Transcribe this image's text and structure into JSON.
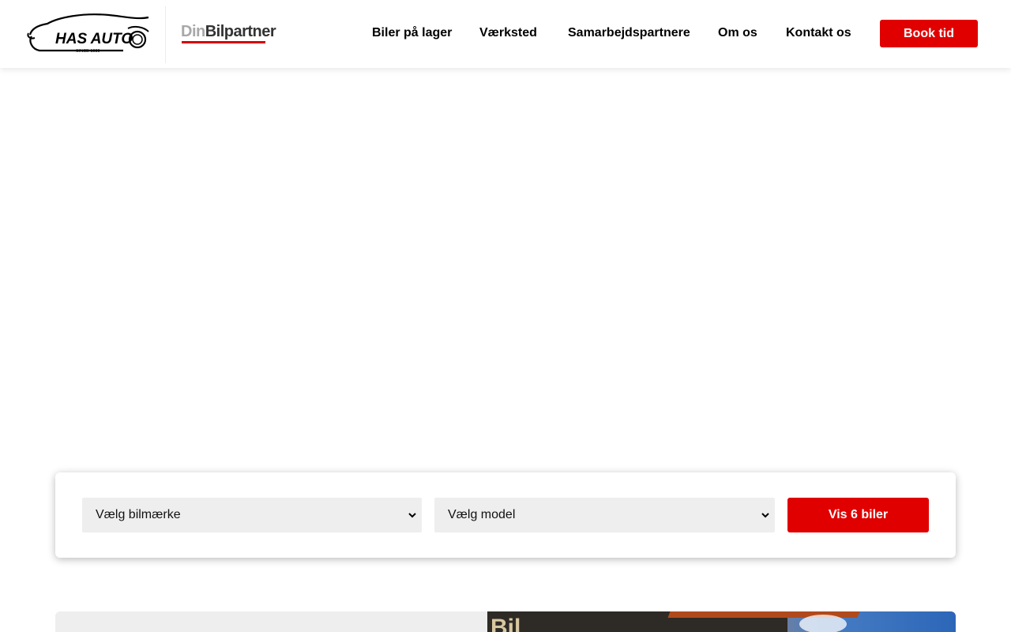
{
  "header": {
    "logo_has": {
      "name": "HAS AUTO",
      "tagline": "SINCE 1989"
    },
    "logo_partner": {
      "part1": "Din",
      "part2": "Bilpartner"
    },
    "nav": [
      {
        "label": "Biler på lager"
      },
      {
        "label": "Værksted"
      },
      {
        "label": "Samarbejdspartnere"
      },
      {
        "label": "Om os"
      },
      {
        "label": "Kontakt os"
      }
    ],
    "cta_label": "Book tid"
  },
  "search": {
    "brand_select": {
      "selected": "Vælg bilmærke",
      "icon": "chevron-down-icon"
    },
    "model_select": {
      "selected": "Vælg model",
      "icon": "chevron-down-icon"
    },
    "submit_label": "Vis 6 biler"
  },
  "colors": {
    "accent": "#e00000",
    "field_bg": "#eeeeee",
    "text": "#000000"
  },
  "bottom_card": {
    "photo_sign_text": "Bil"
  }
}
